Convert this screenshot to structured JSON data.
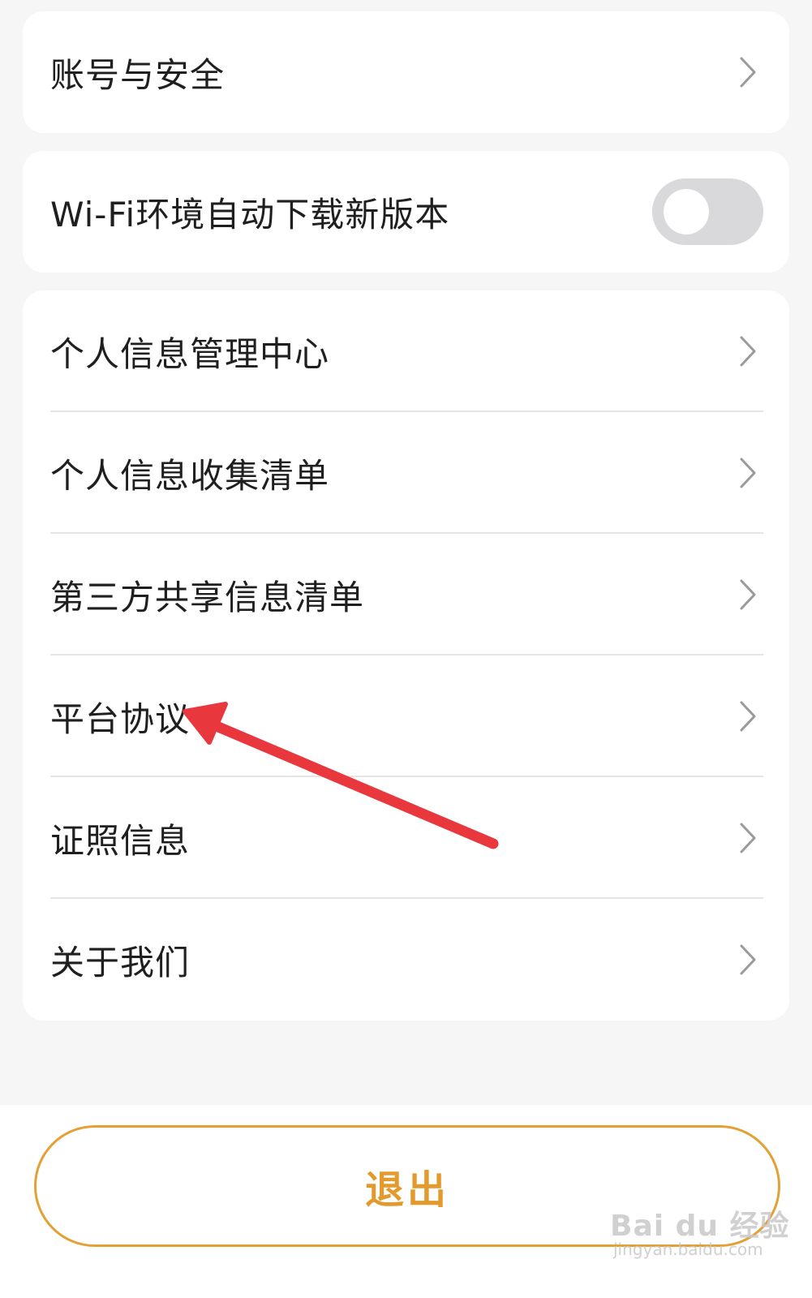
{
  "settings": {
    "account_security": "账号与安全",
    "wifi_auto_download": "Wi-Fi环境自动下载新版本",
    "wifi_auto_download_enabled": false,
    "items": [
      {
        "label": "个人信息管理中心"
      },
      {
        "label": "个人信息收集清单"
      },
      {
        "label": "第三方共享信息清单"
      },
      {
        "label": "平台协议"
      },
      {
        "label": "证照信息"
      },
      {
        "label": "关于我们"
      }
    ]
  },
  "footer": {
    "logout_label": "退出"
  },
  "watermark": {
    "brand": "Bai du 经验",
    "url": "jingyan.baidu.com"
  },
  "colors": {
    "background": "#f6f6f6",
    "card": "#ffffff",
    "text": "#1f1f1f",
    "chevron": "#9a9a9a",
    "toggle_off": "#d9d9dc",
    "accent": "#e3a135",
    "annotation_arrow": "#e8383d"
  },
  "icons": {
    "row_chevron": "chevron-right-icon",
    "annotation": "red-arrow-annotation"
  }
}
